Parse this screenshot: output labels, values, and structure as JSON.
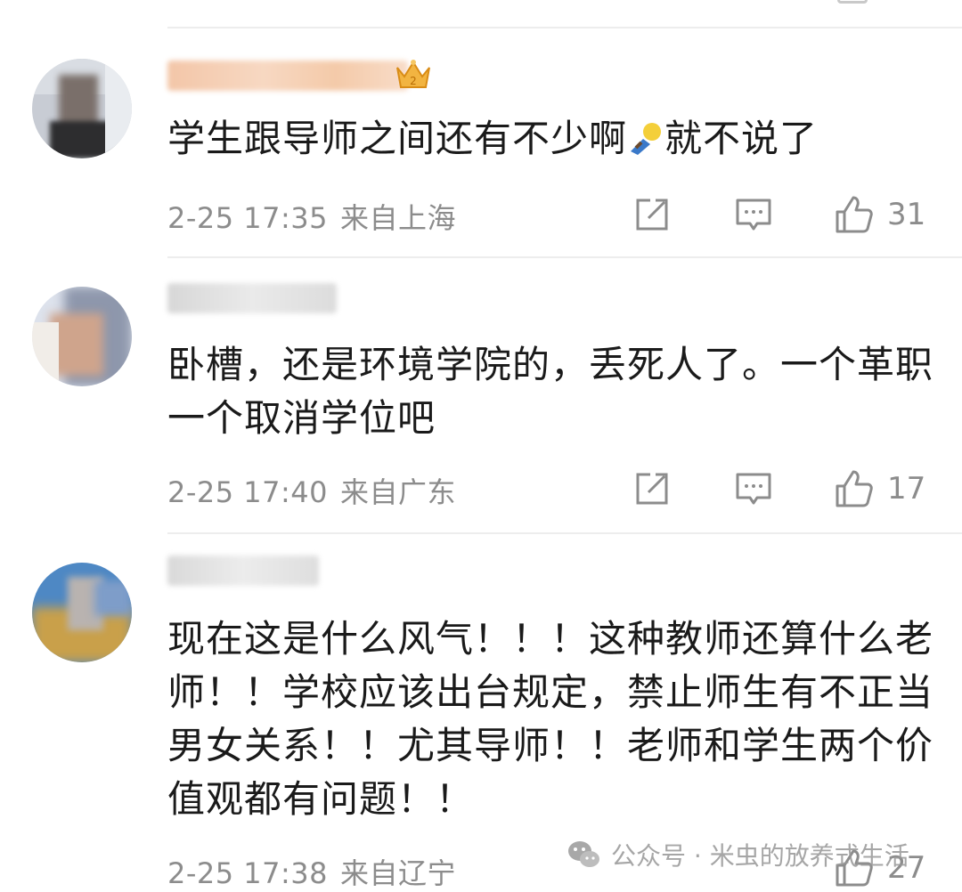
{
  "colors": {
    "text": "#1a1a1a",
    "meta": "#8c8c8c",
    "icon": "#8c8c8c",
    "divider": "#ededed"
  },
  "comments": [
    {
      "text": "学生跟导师之间还有不少啊",
      "text_after_emoji": "就不说了",
      "emoji": "doge-emoji",
      "time": "2-25 17:35",
      "location": "来自上海",
      "likes": "31",
      "badge": "crown-badge-icon"
    },
    {
      "text": "卧槽，还是环境学院的，丢死人了。一个革职一个取消学位吧",
      "time": "2-25 17:40",
      "location": "来自广东",
      "likes": "17"
    },
    {
      "text": "现在这是什么风气！！！这种教师还算什么老师！！学校应该出台规定，禁止师生有不正当男女关系！！尤其导师！！老师和学生两个价值观都有问题！！",
      "time": "2-25 17:38",
      "location": "来自辽宁",
      "likes": "27"
    }
  ],
  "watermark": {
    "icon": "wechat-icon",
    "text": "公众号 · 米虫的放养式生活"
  }
}
